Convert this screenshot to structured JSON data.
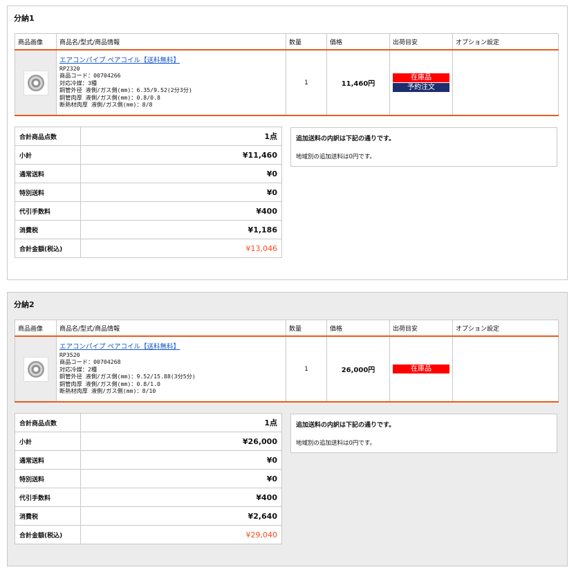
{
  "headers": [
    "商品画像",
    "商品名/型式/商品情報",
    "数量",
    "価格",
    "出荷目安",
    "オプション設定"
  ],
  "summary_labels": [
    "合計商品点数",
    "小計",
    "通常送料",
    "特別送料",
    "代引手数料",
    "消費税",
    "合計金額(税込)"
  ],
  "shipments": [
    {
      "title": "分納1",
      "product": {
        "image_icon": "coil-pipe-image",
        "name": "エアコンパイプ ペアコイル【送料無料】",
        "model": "RP2320",
        "code": "商品コード：00704266",
        "refrigerant": "対応冷媒：3種",
        "outer_diameter": "銅管外径 液側/ガス側(mm)：6.35/9.52(2分3分)",
        "wall_thickness": "銅管肉厚 液側/ガス側(mm)：0.8/0.8",
        "insulation": "断熱材肉厚 液側/ガス側(mm)：8/8",
        "quantity": "1",
        "price": "11,460円",
        "badges": [
          {
            "label": "在庫品",
            "color": "#ff0000"
          },
          {
            "label": "予約注文",
            "color": "#1c2e6e"
          }
        ],
        "option": ""
      },
      "summary_values": [
        "1点",
        "¥11,460",
        "¥0",
        "¥0",
        "¥400",
        "¥1,186",
        "¥13,046"
      ],
      "note": {
        "heading": "追加送料の内訳は下記の通りです。",
        "text": "地域別の追加送料は0円です。"
      }
    },
    {
      "title": "分納2",
      "product": {
        "image_icon": "coil-pipe-image",
        "name": "エアコンパイプ ペアコイル【送料無料】",
        "model": "RP3520",
        "code": "商品コード：00704268",
        "refrigerant": "対応冷媒：2種",
        "outer_diameter": "銅管外径 液側/ガス側(mm)：9.52/15.88(3分5分)",
        "wall_thickness": "銅管肉厚 液側/ガス側(mm)：0.8/1.0",
        "insulation": "断熱材肉厚 液側/ガス側(mm)：8/10",
        "quantity": "1",
        "price": "26,000円",
        "badges": [
          {
            "label": "在庫品",
            "color": "#ff0000"
          }
        ],
        "option": ""
      },
      "summary_values": [
        "1点",
        "¥26,000",
        "¥0",
        "¥0",
        "¥400",
        "¥2,640",
        "¥29,040"
      ],
      "note": {
        "heading": "追加送料の内訳は下記の通りです。",
        "text": "地域別の追加送料は0円です。"
      }
    }
  ],
  "colors": {
    "accent": "#e85a1a",
    "total": "#ff4a1a",
    "link": "#1155cc"
  }
}
